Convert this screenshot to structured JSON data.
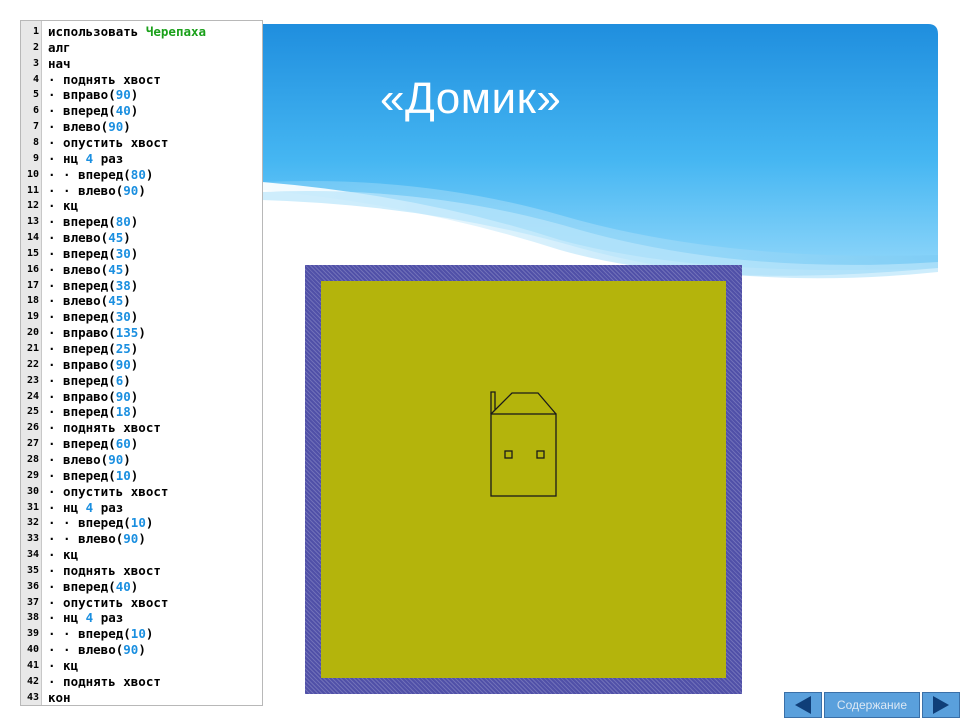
{
  "slide": {
    "title": "«Домик»"
  },
  "code": {
    "lines": [
      {
        "n": "1",
        "t": "использовать ",
        "lib": "Черепаха"
      },
      {
        "n": "2",
        "t": "алг"
      },
      {
        "n": "3",
        "t": "нач"
      },
      {
        "n": "4",
        "t": "· поднять хвост"
      },
      {
        "n": "5",
        "t": "· вправо(",
        "num": "90",
        "e": ")"
      },
      {
        "n": "6",
        "t": "· вперед(",
        "num": "40",
        "e": ")"
      },
      {
        "n": "7",
        "t": "· влево(",
        "num": "90",
        "e": ")"
      },
      {
        "n": "8",
        "t": "· опустить хвост"
      },
      {
        "n": "9",
        "t": "· нц ",
        "num": "4",
        "e": " раз"
      },
      {
        "n": "10",
        "t": "· · вперед(",
        "num": "80",
        "e": ")"
      },
      {
        "n": "11",
        "t": "· · влево(",
        "num": "90",
        "e": ")"
      },
      {
        "n": "12",
        "t": "· кц"
      },
      {
        "n": "13",
        "t": "· вперед(",
        "num": "80",
        "e": ")"
      },
      {
        "n": "14",
        "t": "· влево(",
        "num": "45",
        "e": ")"
      },
      {
        "n": "15",
        "t": "· вперед(",
        "num": "30",
        "e": ")"
      },
      {
        "n": "16",
        "t": "· влево(",
        "num": "45",
        "e": ")"
      },
      {
        "n": "17",
        "t": "· вперед(",
        "num": "38",
        "e": ")"
      },
      {
        "n": "18",
        "t": "· влево(",
        "num": "45",
        "e": ")"
      },
      {
        "n": "19",
        "t": "· вперед(",
        "num": "30",
        "e": ")"
      },
      {
        "n": "20",
        "t": "· вправо(",
        "num": "135",
        "e": ")"
      },
      {
        "n": "21",
        "t": "· вперед(",
        "num": "25",
        "e": ")"
      },
      {
        "n": "22",
        "t": "· вправо(",
        "num": "90",
        "e": ")"
      },
      {
        "n": "23",
        "t": "· вперед(",
        "num": "6",
        "e": ")"
      },
      {
        "n": "24",
        "t": "· вправо(",
        "num": "90",
        "e": ")"
      },
      {
        "n": "25",
        "t": "· вперед(",
        "num": "18",
        "e": ")"
      },
      {
        "n": "26",
        "t": "· поднять хвост"
      },
      {
        "n": "27",
        "t": "· вперед(",
        "num": "60",
        "e": ")"
      },
      {
        "n": "28",
        "t": "· влево(",
        "num": "90",
        "e": ")"
      },
      {
        "n": "29",
        "t": "· вперед(",
        "num": "10",
        "e": ")"
      },
      {
        "n": "30",
        "t": "· опустить хвост"
      },
      {
        "n": "31",
        "t": "· нц ",
        "num": "4",
        "e": " раз"
      },
      {
        "n": "32",
        "t": "· · вперед(",
        "num": "10",
        "e": ")"
      },
      {
        "n": "33",
        "t": "· · влево(",
        "num": "90",
        "e": ")"
      },
      {
        "n": "34",
        "t": "· кц"
      },
      {
        "n": "35",
        "t": "· поднять хвост"
      },
      {
        "n": "36",
        "t": "· вперед(",
        "num": "40",
        "e": ")"
      },
      {
        "n": "37",
        "t": "· опустить хвост"
      },
      {
        "n": "38",
        "t": "· нц ",
        "num": "4",
        "e": " раз"
      },
      {
        "n": "39",
        "t": "· · вперед(",
        "num": "10",
        "e": ")"
      },
      {
        "n": "40",
        "t": "· · влево(",
        "num": "90",
        "e": ")"
      },
      {
        "n": "41",
        "t": "· кц"
      },
      {
        "n": "42",
        "t": "· поднять хвост"
      },
      {
        "n": "43",
        "t": "кон"
      }
    ]
  },
  "nav": {
    "contents_label": "Содержание",
    "prev_icon": "triangle-left-icon",
    "next_icon": "triangle-right-icon"
  },
  "colors": {
    "canvas_field": "#b4b40c",
    "canvas_border": "#5050a8",
    "header_blue": "#2f9fe6",
    "number_blue": "#1a8fe0",
    "library_green": "#1aa01a"
  }
}
